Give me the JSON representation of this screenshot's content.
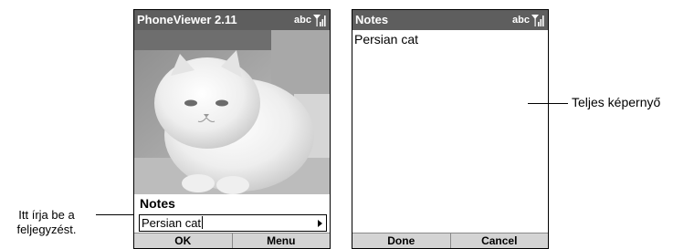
{
  "left_screen": {
    "title": "PhoneViewer 2.11",
    "input_mode": "abc",
    "notes_label": "Notes",
    "note_value": "Persian cat",
    "softkey_left": "OK",
    "softkey_right": "Menu"
  },
  "right_screen": {
    "title": "Notes",
    "input_mode": "abc",
    "note_text": "Persian cat",
    "softkey_left": "Done",
    "softkey_right": "Cancel"
  },
  "callouts": {
    "left_line1": "Itt írja be a",
    "left_line2": "feljegyzést.",
    "right": "Teljes képernyő"
  },
  "icons": {
    "signal": "signal-strength-icon",
    "arrow": "arrow-right-icon",
    "photo": "cat-photo"
  },
  "colors": {
    "titlebar": "#5e5e5e",
    "softkey_bar": "#d4d4d4"
  }
}
